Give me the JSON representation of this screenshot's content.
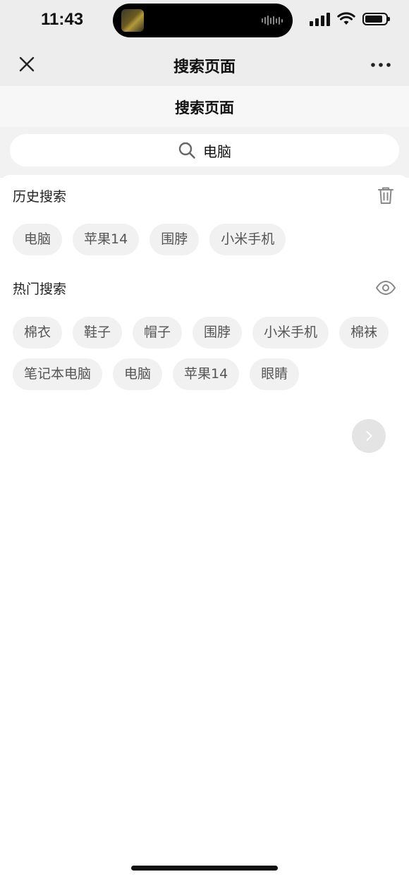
{
  "status_bar": {
    "time": "11:43",
    "battery_level": 0.85,
    "icons": [
      "cellular-signal-icon",
      "wifi-icon",
      "battery-icon"
    ]
  },
  "nav": {
    "title": "搜索页面",
    "close_icon": "close-icon",
    "more_icon": "more-icon"
  },
  "page": {
    "title": "搜索页面"
  },
  "search": {
    "value": "电脑",
    "icon": "search-icon"
  },
  "history": {
    "title": "历史搜索",
    "action_icon": "trash-icon",
    "tags": [
      "电脑",
      "苹果14",
      "围脖",
      "小米手机"
    ]
  },
  "hot": {
    "title": "热门搜索",
    "action_icon": "eye-icon",
    "tags": [
      "棉衣",
      "鞋子",
      "帽子",
      "围脖",
      "小米手机",
      "棉袜",
      "笔记本电脑",
      "电脑",
      "苹果14",
      "眼睛"
    ]
  },
  "fab": {
    "icon": "chevron-right-icon"
  },
  "colors": {
    "nav_background": "#ededed",
    "search_area_background": "#f2f2f2",
    "tag_background": "#f1f1f1",
    "tag_text": "#555555"
  }
}
